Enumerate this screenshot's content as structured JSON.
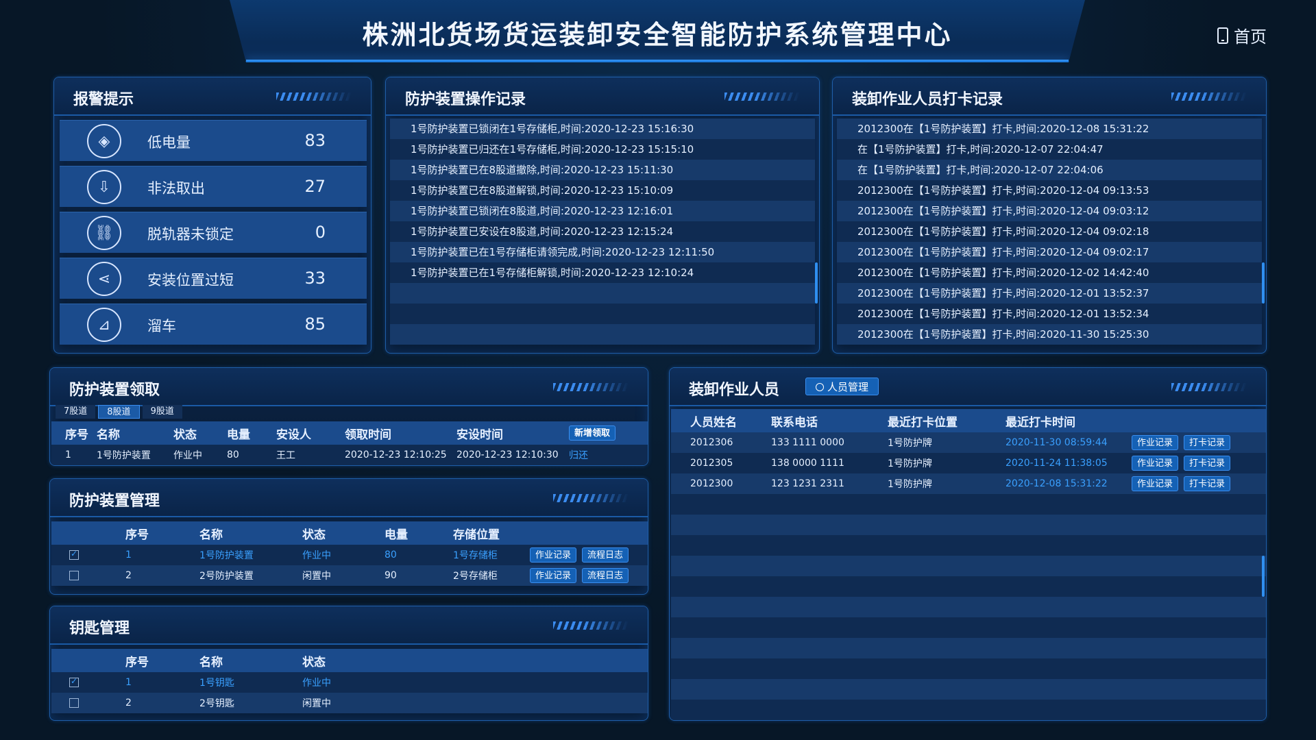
{
  "header": {
    "title": "株洲北货场货运装卸安全智能防护系统管理中心",
    "home_label": "首页"
  },
  "alarm": {
    "title": "报警提示",
    "items": [
      {
        "icon": "layers-icon",
        "label": "低电量",
        "value": "83"
      },
      {
        "icon": "download-screen-icon",
        "label": "非法取出",
        "value": "27"
      },
      {
        "icon": "link-icon",
        "label": "脱轨器未锁定",
        "value": "0"
      },
      {
        "icon": "share-icon",
        "label": "安装位置过短",
        "value": "33"
      },
      {
        "icon": "ramp-icon",
        "label": "溜车",
        "value": "85"
      }
    ]
  },
  "device_log": {
    "title": "防护装置操作记录",
    "rows": [
      "1号防护装置已锁闭在1号存储柜,时间:2020-12-23 15:16:30",
      "1号防护装置已归还在1号存储柜,时间:2020-12-23 15:15:10",
      "1号防护装置已在8股道撤除,时间:2020-12-23 15:11:30",
      "1号防护装置已在8股道解锁,时间:2020-12-23 15:10:09",
      "1号防护装置已锁闭在8股道,时间:2020-12-23 12:16:01",
      "1号防护装置已安设在8股道,时间:2020-12-23 12:15:24",
      "1号防护装置已在1号存储柜请领完成,时间:2020-12-23 12:11:50",
      "1号防护装置已在1号存储柜解锁,时间:2020-12-23 12:10:24"
    ]
  },
  "checkin_log": {
    "title": "装卸作业人员打卡记录",
    "rows": [
      "2012300在【1号防护装置】打卡,时间:2020-12-08 15:31:22",
      "在【1号防护装置】打卡,时间:2020-12-07 22:04:47",
      "在【1号防护装置】打卡,时间:2020-12-07 22:04:06",
      "2012300在【1号防护装置】打卡,时间:2020-12-04 09:13:53",
      "2012300在【1号防护装置】打卡,时间:2020-12-04 09:03:12",
      "2012300在【1号防护装置】打卡,时间:2020-12-04 09:02:18",
      "2012300在【1号防护装置】打卡,时间:2020-12-04 09:02:17",
      "2012300在【1号防护装置】打卡,时间:2020-12-02 14:42:40",
      "2012300在【1号防护装置】打卡,时间:2020-12-01 13:52:37",
      "2012300在【1号防护装置】打卡,时间:2020-12-01 13:52:34",
      "2012300在【1号防护装置】打卡,时间:2020-11-30 15:25:30"
    ]
  },
  "pickup": {
    "title": "防护装置领取",
    "tabs": [
      "7股道",
      "8股道",
      "9股道"
    ],
    "active_tab": 1,
    "headers": [
      "序号",
      "名称",
      "状态",
      "电量",
      "安设人",
      "领取时间",
      "安设时间"
    ],
    "new_button": "新增领取",
    "rows": [
      {
        "no": "1",
        "name": "1号防护装置",
        "status": "作业中",
        "power": "80",
        "installer": "王工",
        "pickup_time": "2020-12-23 12:10:25",
        "install_time": "2020-12-23 12:10:30",
        "action": "归还"
      }
    ]
  },
  "device_mgmt": {
    "title": "防护装置管理",
    "headers": [
      "序号",
      "名称",
      "状态",
      "电量",
      "存储位置"
    ],
    "btn_work": "作业记录",
    "btn_flow": "流程日志",
    "rows": [
      {
        "checked": true,
        "no": "1",
        "name": "1号防护装置",
        "status": "作业中",
        "power": "80",
        "location": "1号存储柜"
      },
      {
        "checked": false,
        "no": "2",
        "name": "2号防护装置",
        "status": "闲置中",
        "power": "90",
        "location": "2号存储柜"
      }
    ]
  },
  "key_mgmt": {
    "title": "钥匙管理",
    "headers": [
      "序号",
      "名称",
      "状态"
    ],
    "rows": [
      {
        "checked": true,
        "no": "1",
        "name": "1号钥匙",
        "status": "作业中"
      },
      {
        "checked": false,
        "no": "2",
        "name": "2号钥匙",
        "status": "闲置中"
      }
    ]
  },
  "personnel": {
    "title": "装卸作业人员",
    "manage_button": "人员管理",
    "headers": [
      "人员姓名",
      "联系电话",
      "最近打卡位置",
      "最近打卡时间"
    ],
    "btn_work": "作业记录",
    "btn_checkin": "打卡记录",
    "rows": [
      {
        "name": "2012306",
        "phone": "133 1111 0000",
        "location": "1号防护牌",
        "time": "2020-11-30 08:59:44"
      },
      {
        "name": "2012305",
        "phone": "138 0000 1111",
        "location": "1号防护牌",
        "time": "2020-11-24 11:38:05"
      },
      {
        "name": "2012300",
        "phone": "123 1231 2311",
        "location": "1号防护牌",
        "time": "2020-12-08 15:31:22"
      }
    ]
  },
  "colors": {
    "accent": "#2f8ff0",
    "link": "#3aa0ff",
    "panel_bg": "#081c36",
    "row_highlight": "#1b4b8c"
  }
}
